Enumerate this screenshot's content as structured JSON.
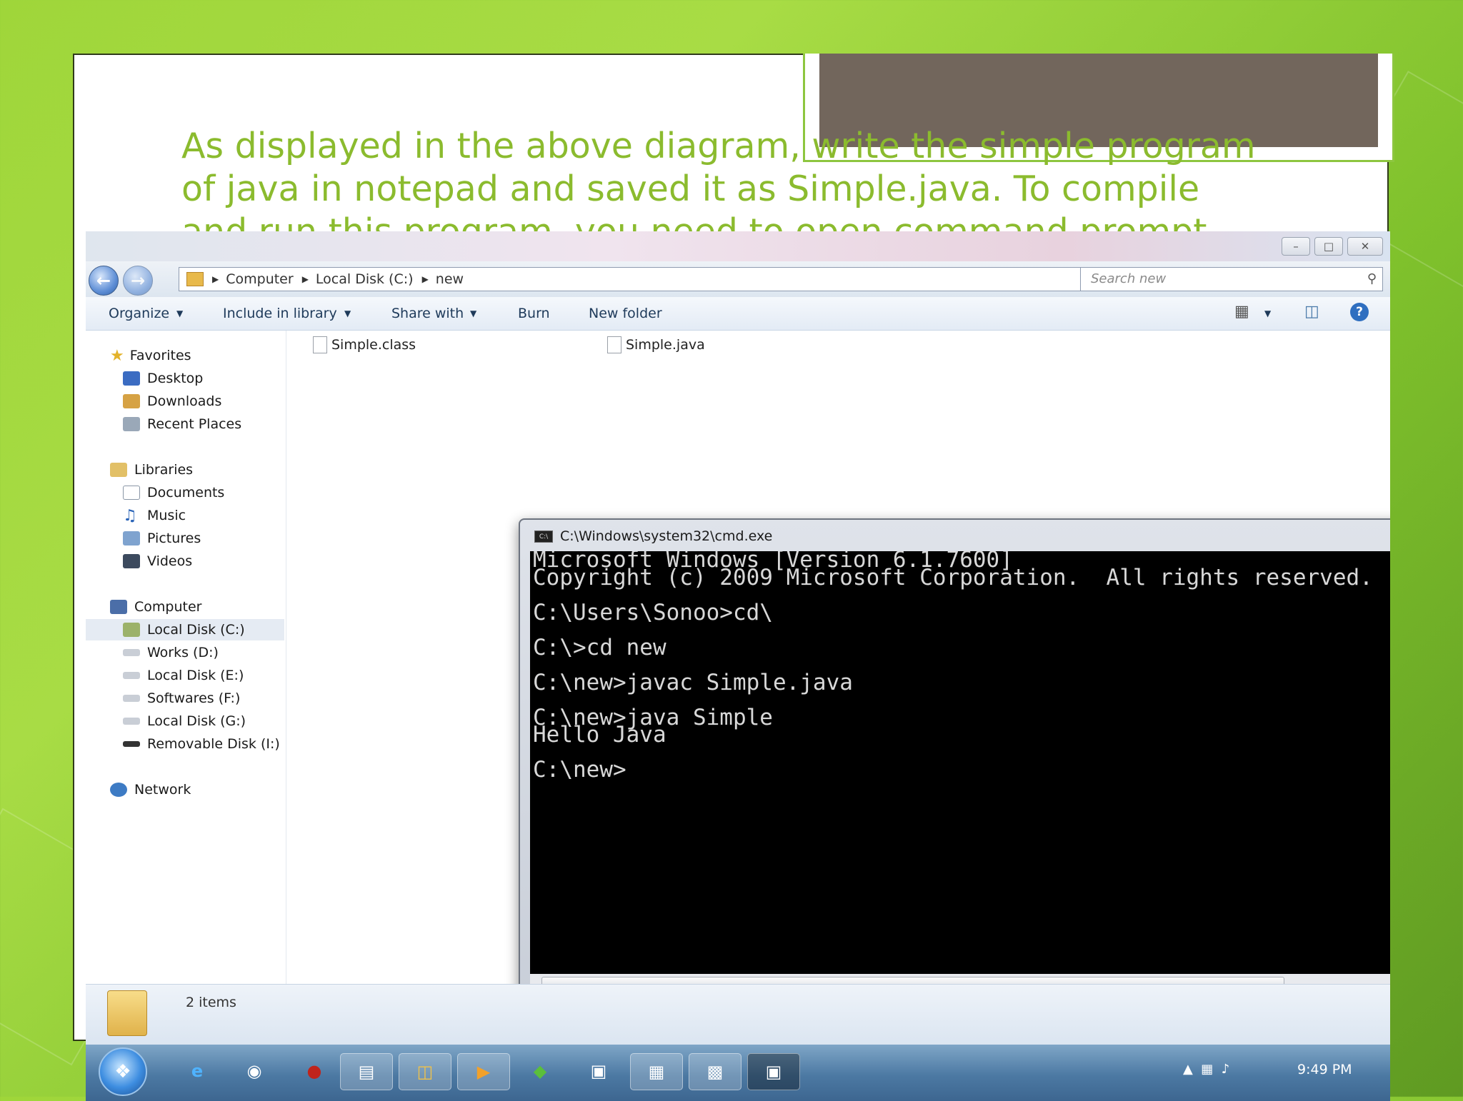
{
  "slide": {
    "body_lines": [
      "As displayed in the above diagram, write the simple program",
      "of java in notepad and saved it as Simple.java. To compile",
      "and run this program, you need to open command prompt"
    ]
  },
  "explorer": {
    "breadcrumbs": [
      "Computer",
      "Local Disk (C:)",
      "new"
    ],
    "search_placeholder": "Search new",
    "toolbar": [
      "Organize",
      "Include in library",
      "Share with",
      "Burn",
      "New folder"
    ],
    "nav": {
      "favorites": "Favorites",
      "favorite_items": [
        "Desktop",
        "Downloads",
        "Recent Places"
      ],
      "libraries": "Libraries",
      "library_items": [
        "Documents",
        "Music",
        "Pictures",
        "Videos"
      ],
      "computer": "Computer",
      "drives": [
        "Local Disk (C:)",
        "Works (D:)",
        "Local Disk (E:)",
        "Softwares (F:)",
        "Local Disk (G:)",
        "Removable Disk (I:)"
      ],
      "network": "Network"
    },
    "files": [
      "Simple.class",
      "Simple.java"
    ],
    "status": "2 items"
  },
  "cmd": {
    "title": "C:\\Windows\\system32\\cmd.exe",
    "lines": [
      "Microsoft Windows [Version 6.1.7600]",
      "Copyright (c) 2009 Microsoft Corporation.  All rights reserved.",
      "",
      "C:\\Users\\Sonoo>cd\\",
      "",
      "C:\\>cd new",
      "",
      "C:\\new>javac Simple.java",
      "",
      "C:\\new>java Simple",
      "Hello Java",
      "",
      "C:\\new>"
    ]
  },
  "taskbar": {
    "clock": "9:49 PM"
  },
  "icons": {
    "nav_back": "back-arrow-icon",
    "nav_forward": "forward-arrow-icon",
    "search": "search-icon",
    "help": "help-icon"
  },
  "colors": {
    "slide_text": "#8bbb2e",
    "title_fill": "#72665c",
    "background_green": "#9fd63a"
  }
}
